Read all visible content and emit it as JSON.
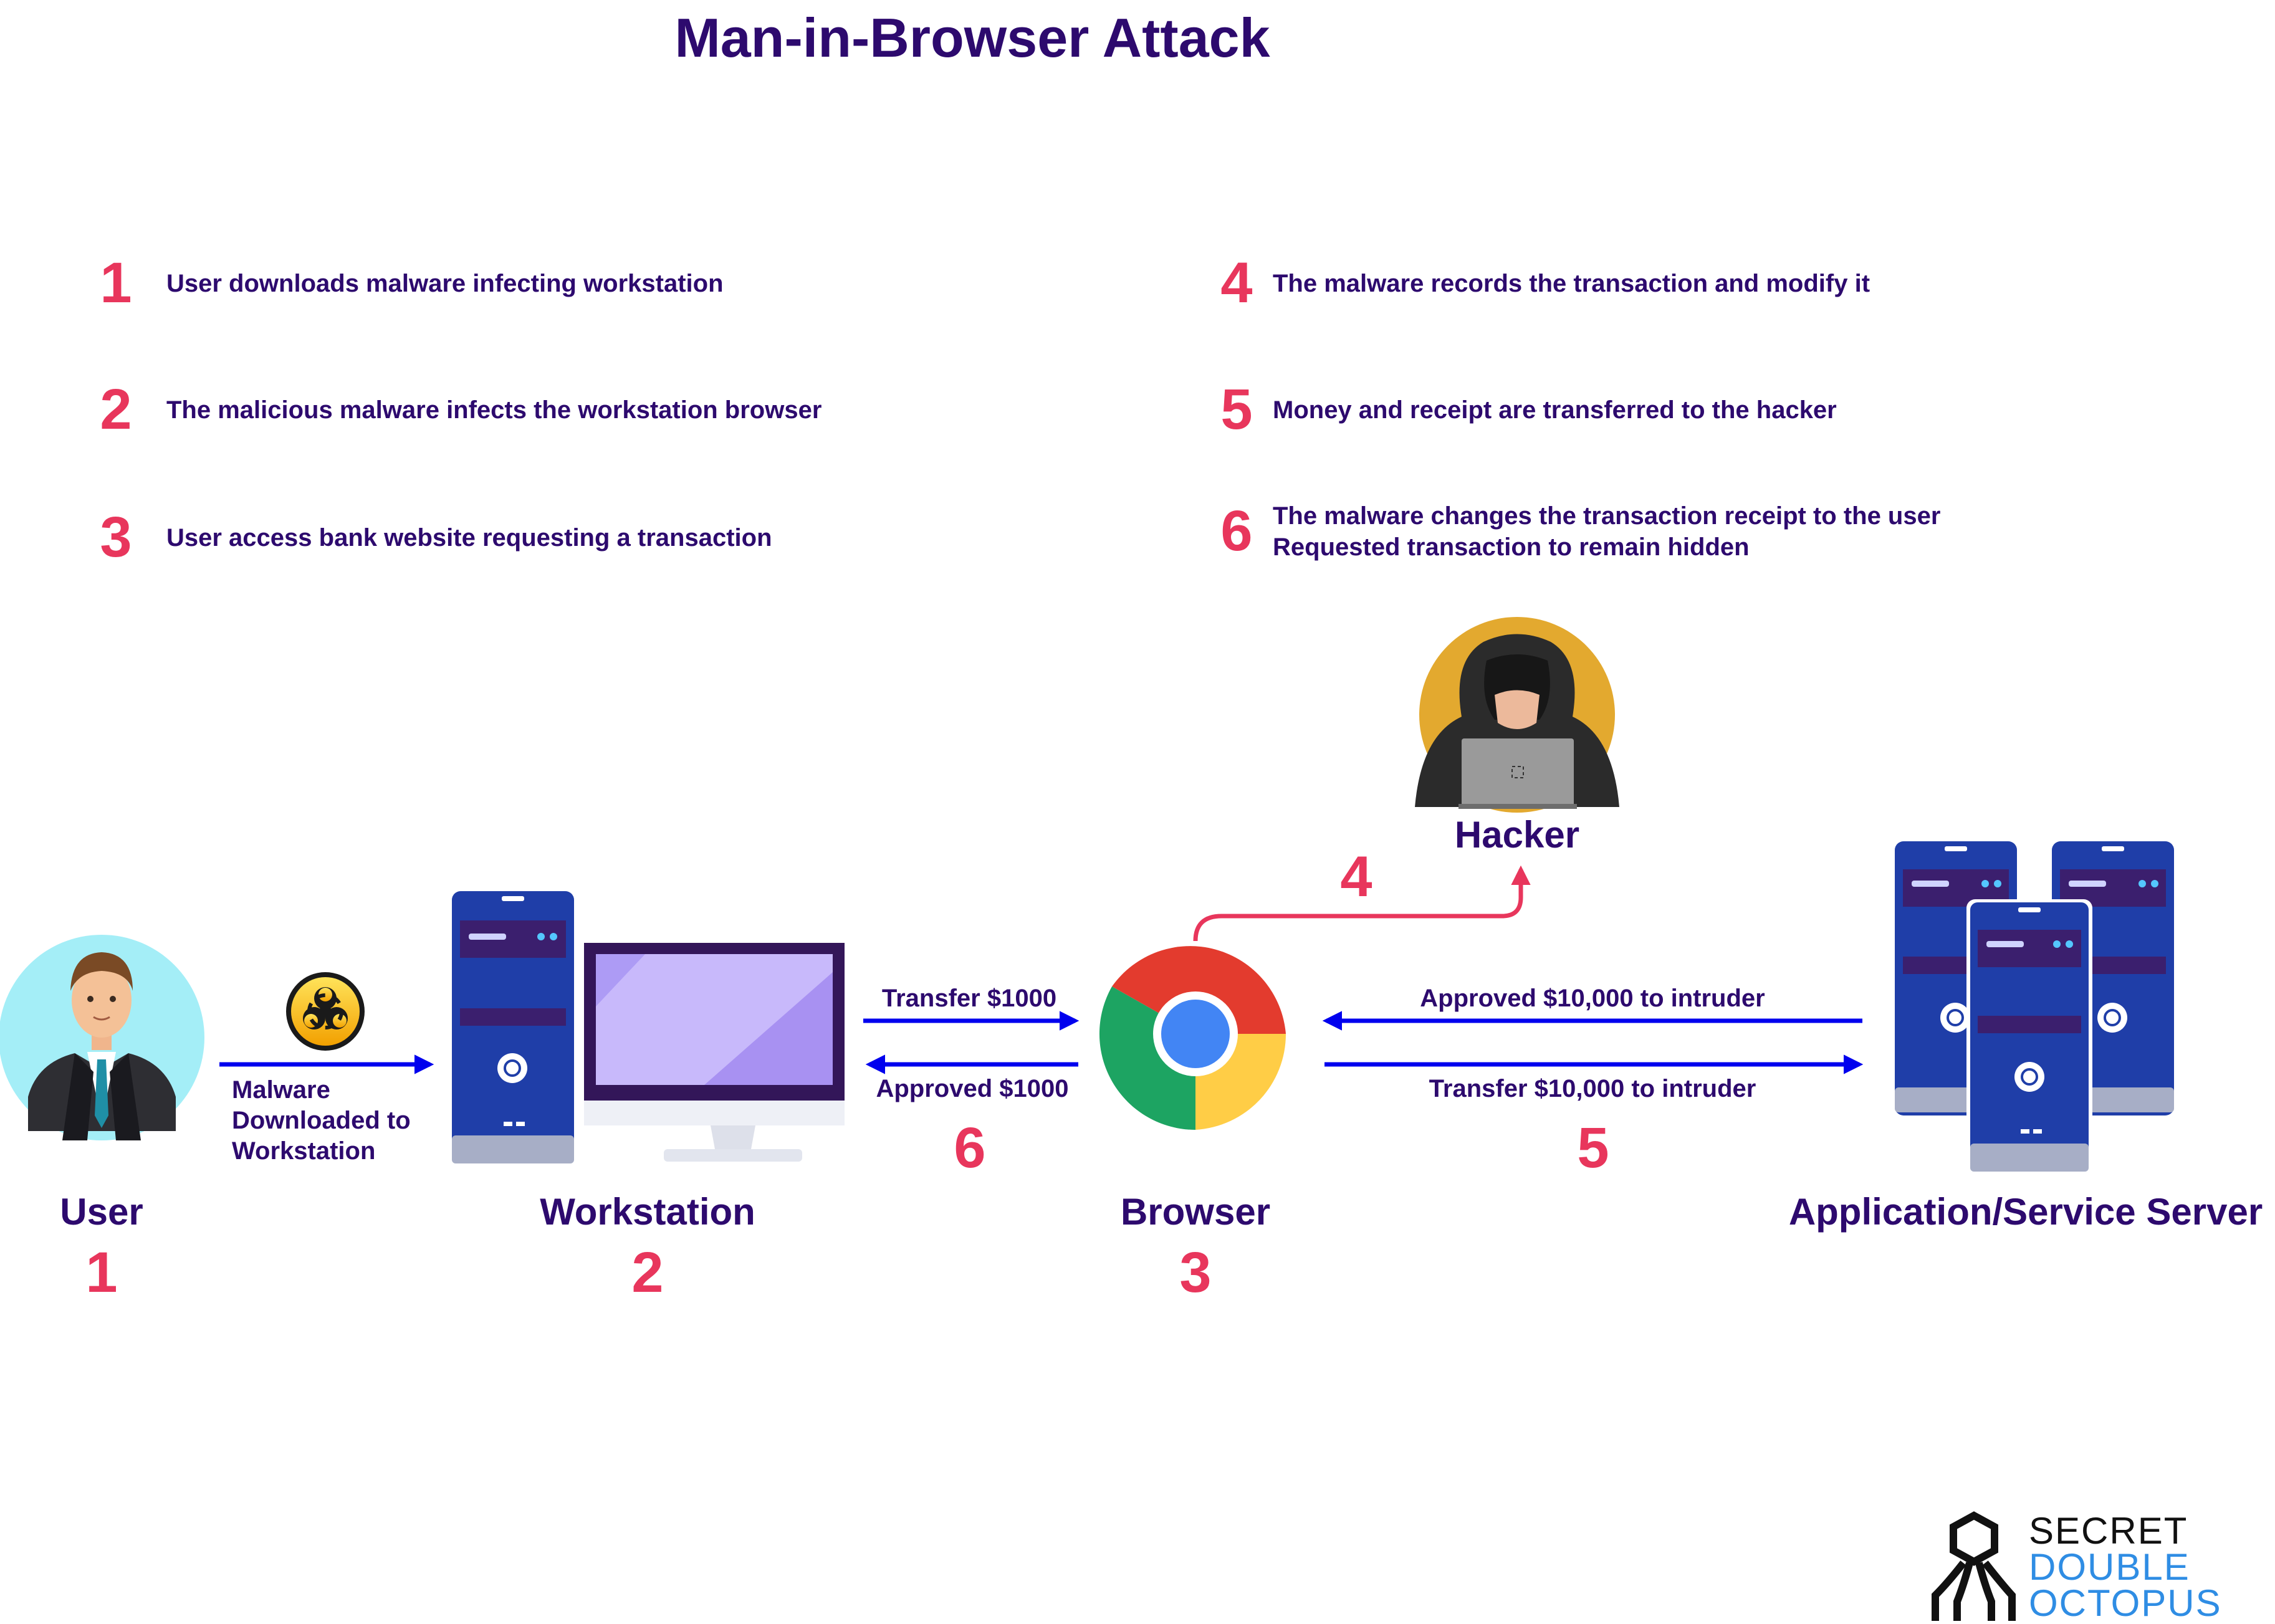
{
  "title": "Man-in-Browser Attack",
  "steps": [
    {
      "num": "1",
      "text": "User downloads malware infecting workstation"
    },
    {
      "num": "2",
      "text": "The malicious malware infects the workstation browser"
    },
    {
      "num": "3",
      "text": "User access bank website requesting a transaction"
    },
    {
      "num": "4",
      "text": "The malware records the transaction and modify it"
    },
    {
      "num": "5",
      "text": "Money and receipt are transferred to the hacker"
    },
    {
      "num": "6",
      "line1": "The malware changes the transaction receipt to the user",
      "line2": "Requested transaction to remain hidden"
    }
  ],
  "nodes": {
    "user": {
      "label": "User",
      "num": "1"
    },
    "workstation": {
      "label": "Workstation",
      "num": "2"
    },
    "browser": {
      "label": "Browser",
      "num": "3"
    },
    "hacker": {
      "label": "Hacker"
    },
    "server": {
      "label": "Application/Service Server"
    }
  },
  "edges": {
    "malware": {
      "line1": "Malware",
      "line2": "Downloaded to",
      "line3": "Workstation"
    },
    "transfer_small": {
      "label": "Transfer $1000"
    },
    "approved_small": {
      "label": "Approved $1000",
      "num": "6"
    },
    "approved_big": {
      "label": "Approved $10,000 to intruder"
    },
    "transfer_big": {
      "label": "Transfer $10,000 to intruder",
      "num": "5"
    },
    "to_hacker": {
      "num": "4"
    }
  },
  "logo": {
    "line1": "SECRET",
    "line2": "DOUBLE",
    "line3": "OCTOPUS"
  },
  "colors": {
    "title": "#2d0a6e",
    "accent_number": "#e8365c",
    "arrow_blue": "#0000ee",
    "arrow_pink": "#e8365c",
    "logo_blue": "#2f8de4"
  },
  "icons": [
    "user-avatar",
    "biohazard-icon",
    "desktop-computer",
    "chrome-browser-icon",
    "hacker-avatar",
    "server-tower-icon",
    "octopus-logo-icon"
  ]
}
